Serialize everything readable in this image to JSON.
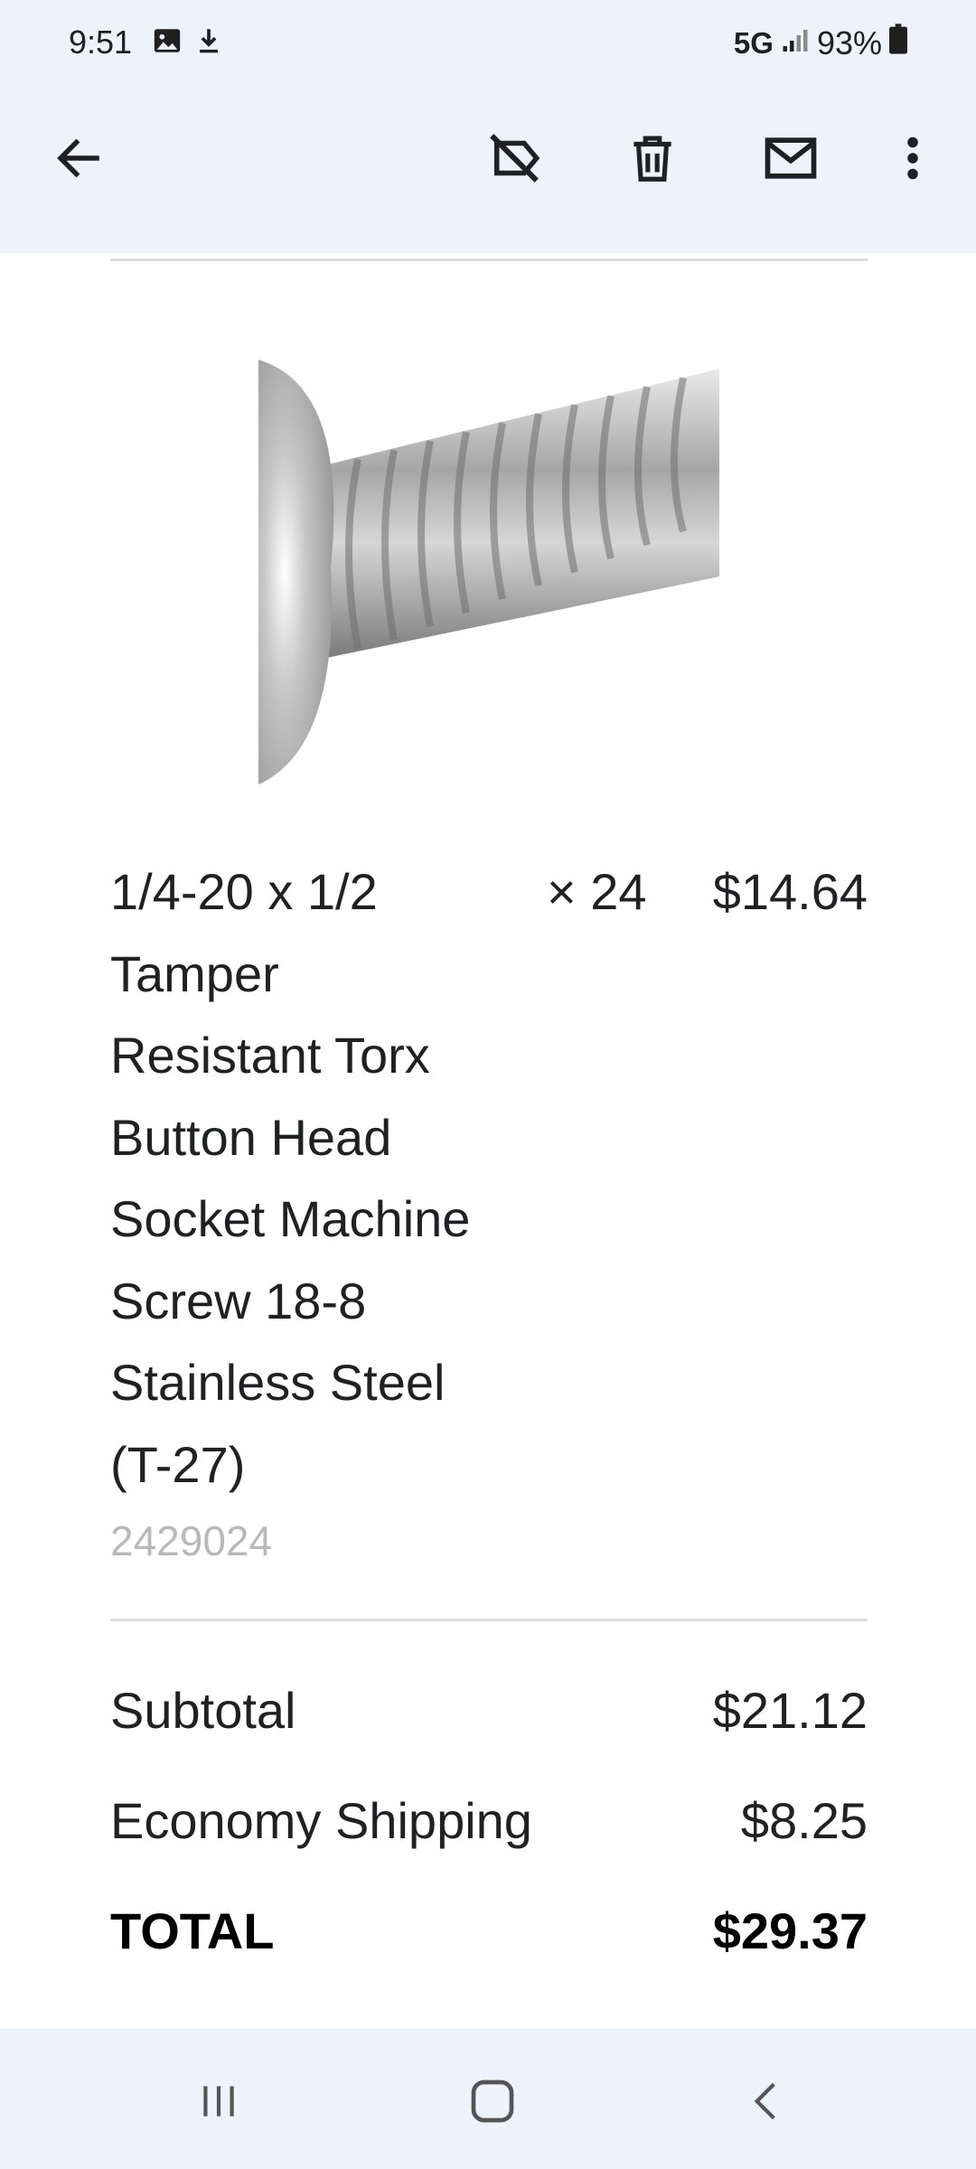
{
  "status_bar": {
    "time": "9:51",
    "network": "5G",
    "battery": "93%",
    "icons": [
      "gallery-icon",
      "download-icon",
      "signal-icon",
      "battery-icon"
    ]
  },
  "app_bar": {
    "actions": [
      "back-arrow-icon",
      "label-off-icon",
      "delete-icon",
      "mail-icon",
      "more-vert-icon"
    ]
  },
  "order_item": {
    "name_lines": [
      "1/4-20 x 1/2",
      "Tamper",
      "Resistant Torx",
      "Button Head",
      "Socket Machine",
      "Screw 18-8",
      "Stainless Steel",
      "(T-27)"
    ],
    "quantity": "× 24",
    "price": "$14.64",
    "sku": "2429024"
  },
  "summary": {
    "subtotal_label": "Subtotal",
    "subtotal_value": "$21.12",
    "shipping_label": "Economy Shipping",
    "shipping_value": "$8.25",
    "total_label": "TOTAL",
    "total_value": "$29.37"
  },
  "nav_bar": {
    "buttons": [
      "recent-apps-icon",
      "home-icon",
      "back-nav-icon"
    ]
  },
  "colors": {
    "chrome_bg": "#eef2fb",
    "divider": "#dadce0",
    "sku_text": "#b9b9b9"
  }
}
